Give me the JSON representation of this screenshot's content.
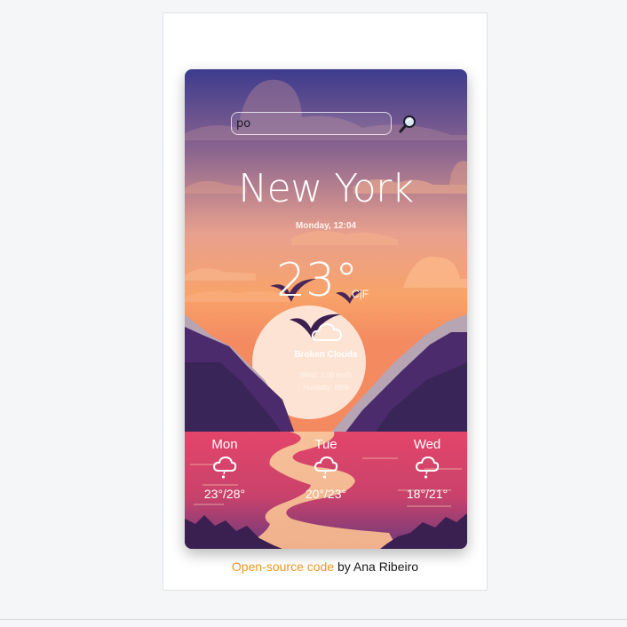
{
  "search": {
    "value": "po"
  },
  "current": {
    "city": "New York",
    "datetime": "Monday, 12:04",
    "temperature": "23°",
    "unit_celsius": "C",
    "unit_separator": "|",
    "unit_fahrenheit": "F",
    "description": "Broken Clouds",
    "wind": "Wind: 3.09 km/h",
    "humidity": "Humidity: 88%",
    "icon": "broken-clouds-icon"
  },
  "forecast": [
    {
      "day": "Mon",
      "temp": "23°/28°",
      "icon": "rain-cloud-icon"
    },
    {
      "day": "Tue",
      "temp": "20°/23°",
      "icon": "rain-cloud-icon"
    },
    {
      "day": "Wed",
      "temp": "18°/21°",
      "icon": "rain-cloud-icon"
    }
  ],
  "footer": {
    "link_text": "Open-source code",
    "suffix": " by Ana Ribeiro"
  },
  "colors": {
    "link": "#f0961e",
    "sky_top": "#3d3b8e",
    "sky_bottom": "#f8a36a",
    "sea": "#e2476a"
  }
}
